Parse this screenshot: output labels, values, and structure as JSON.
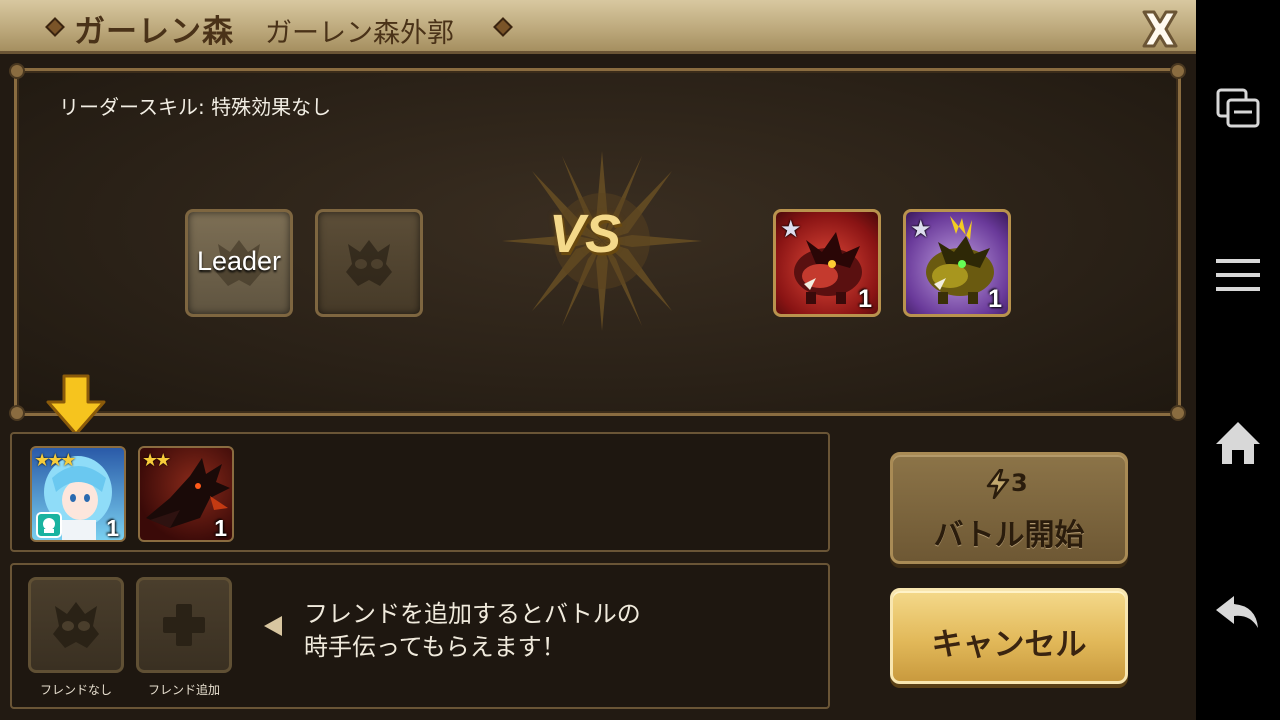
{
  "title": {
    "area": "ガーレン森",
    "stage": "ガーレン森外郭"
  },
  "leader_skill": "リーダースキル: 特殊効果なし",
  "ally_slots": {
    "leader_label": "Leader"
  },
  "vs_label": "VS",
  "enemies": [
    {
      "name": "red-boar",
      "stars": 1,
      "level": "1",
      "color": "#b02424"
    },
    {
      "name": "yellow-boar",
      "stars": 1,
      "level": "1",
      "color": "#9c8a18"
    }
  ],
  "monsters": [
    {
      "name": "water-fairy",
      "stars": 3,
      "star_text": "★★★",
      "level": "1",
      "color": "#5ab8e6"
    },
    {
      "name": "dark-dragon",
      "stars": 2,
      "star_text": "★★",
      "level": "1",
      "color": "#6a1410"
    }
  ],
  "friends": {
    "no_friend_label": "フレンドなし",
    "add_friend_label": "フレンド追加",
    "hint": "フレンドを追加するとバトルの\n時手伝ってもらえます！"
  },
  "buttons": {
    "battle_energy": "3",
    "battle_label": "バトル開始",
    "cancel_label": "キャンセル"
  },
  "icons": {
    "close": "close-icon",
    "energy": "lightning-icon",
    "nav": [
      "recent-apps-icon",
      "menu-icon",
      "home-icon",
      "back-icon"
    ]
  },
  "colors": {
    "title_bar": "#c8b58a",
    "panel_bg": "#2a2117",
    "gold_border": "#8a6c40",
    "cancel_button": "#e2b95a",
    "battle_button": "#7c6640"
  }
}
